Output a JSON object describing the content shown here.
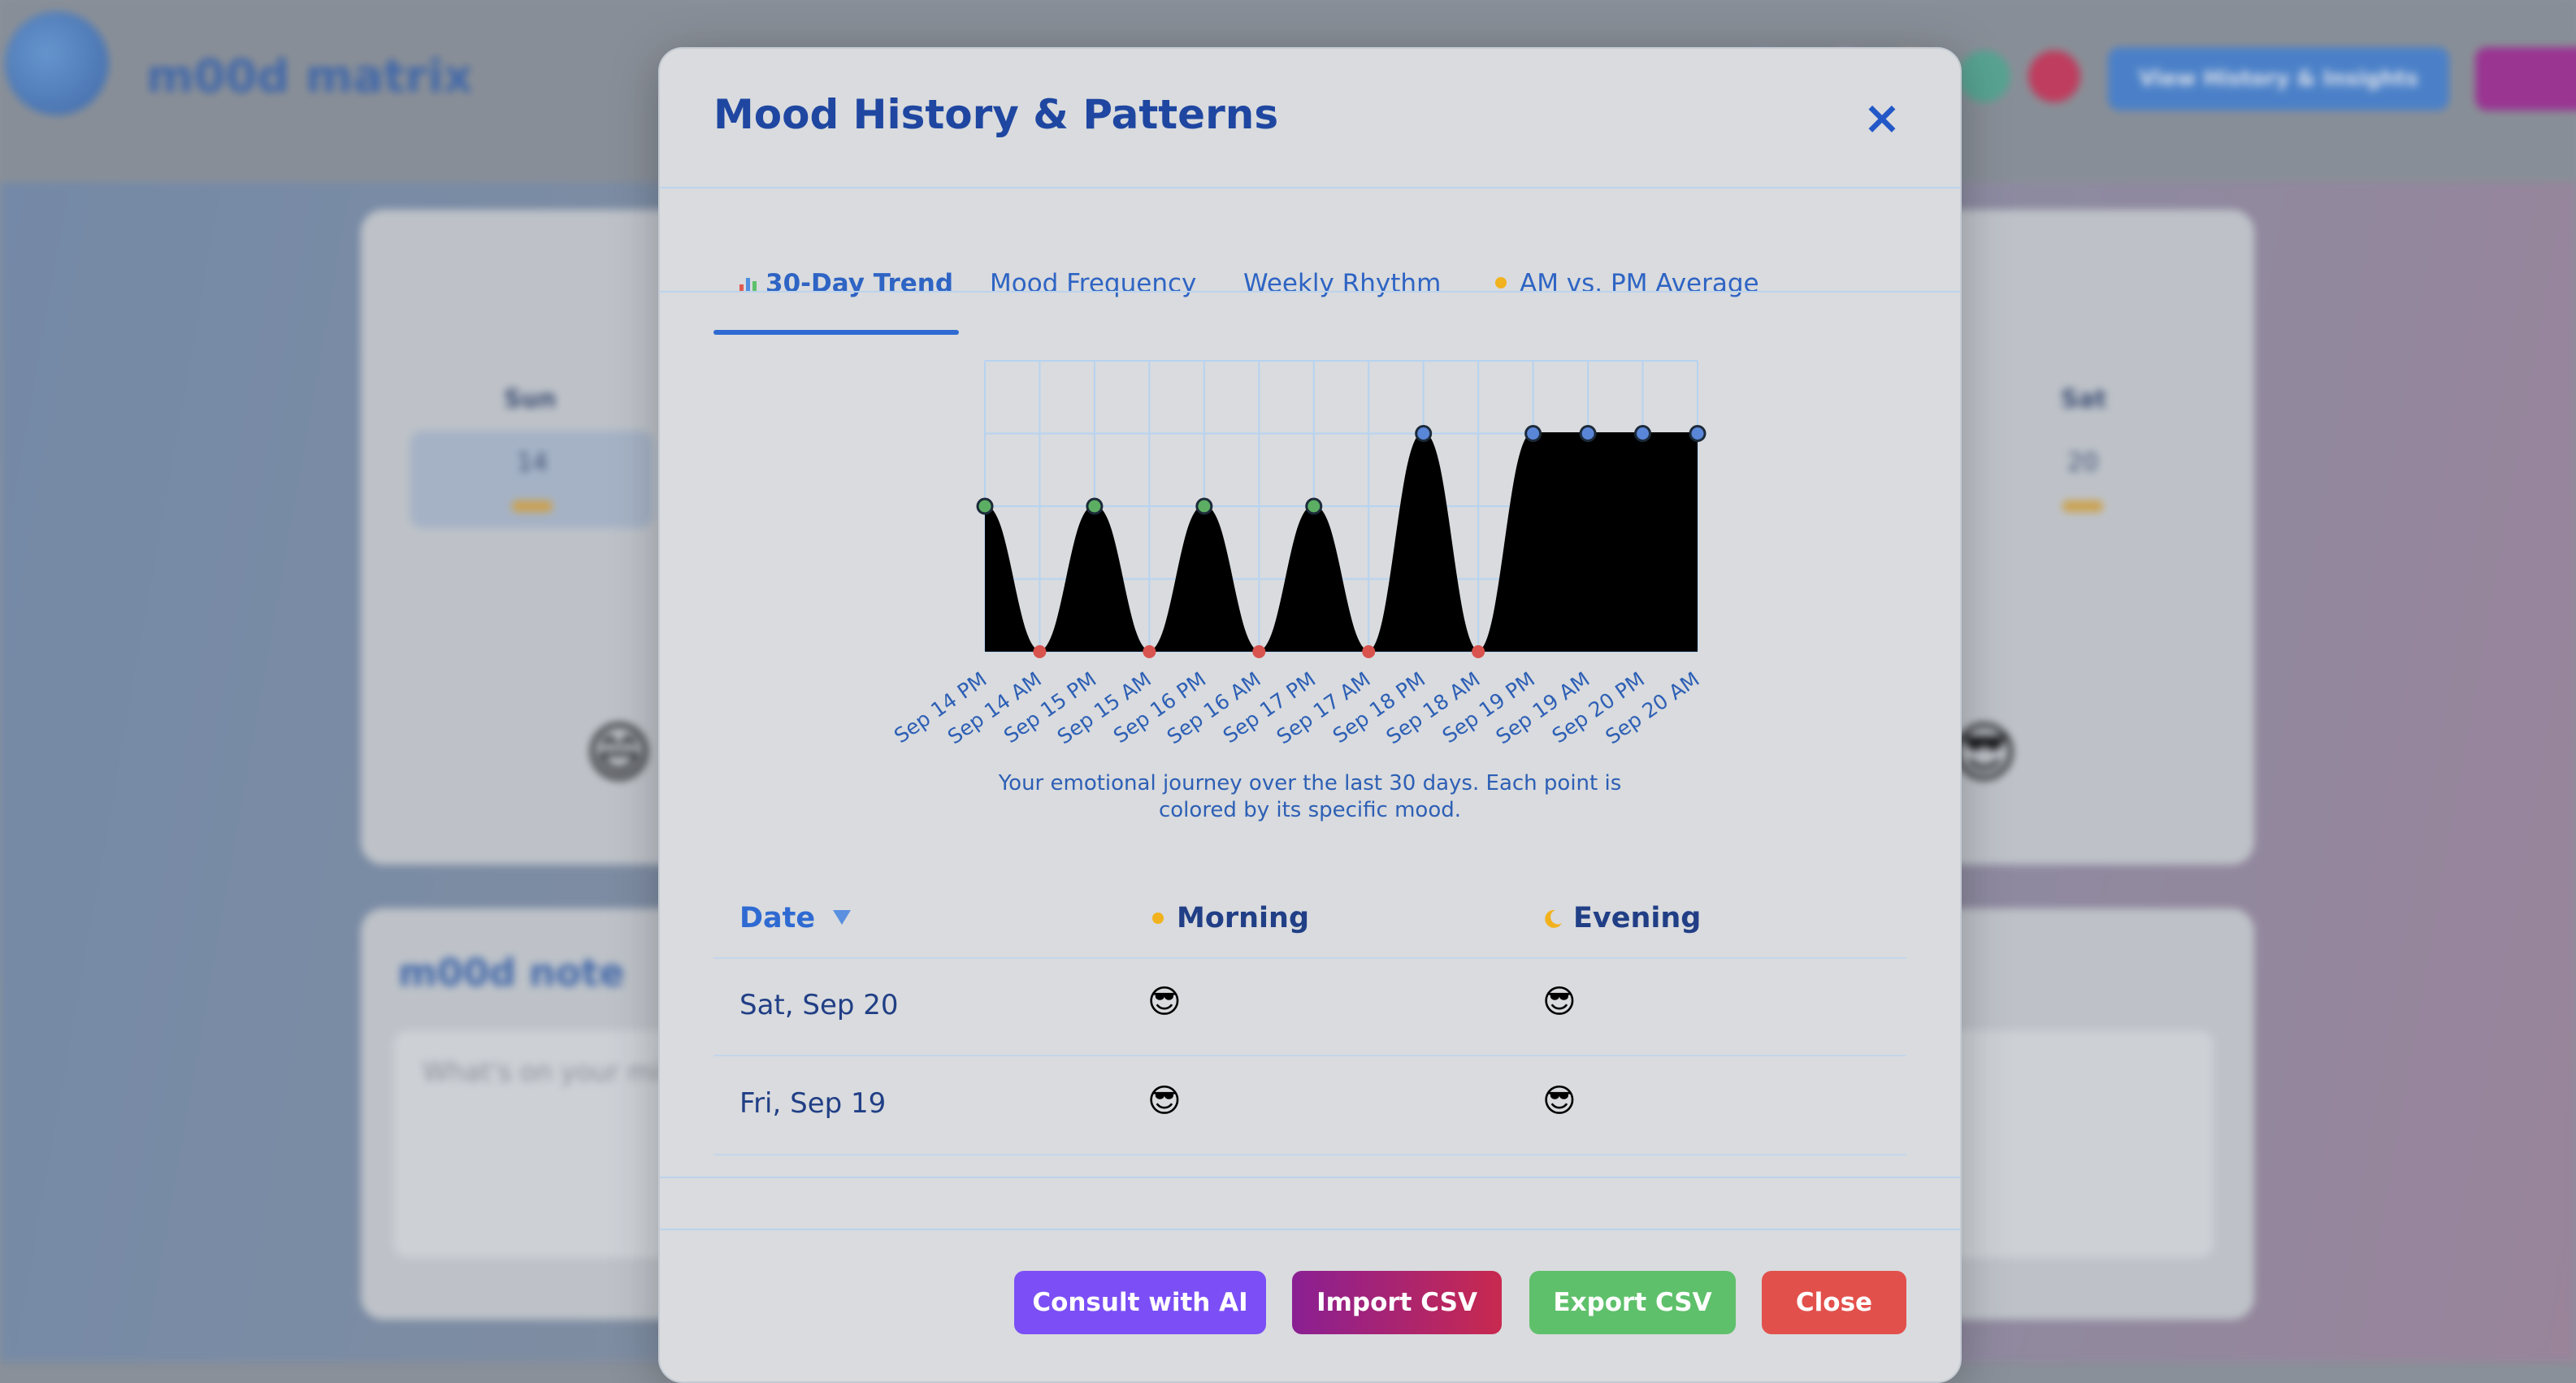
{
  "background": {
    "app_title": "m00d matrix",
    "header_button": "View History & Insights",
    "calendar": {
      "first_day_label": "Sun",
      "first_day_number": "14",
      "last_day_label": "Sat",
      "last_day_number": "20"
    },
    "note_title": "m00d note",
    "note_placeholder": "What's on your mind"
  },
  "modal": {
    "title": "Mood History & Patterns",
    "close_icon": "×",
    "tabs": [
      {
        "label": "30-Day Trend",
        "icon": "bar-chart-icon",
        "active": true
      },
      {
        "label": "Mood Frequency",
        "active": false
      },
      {
        "label": "Weekly Rhythm",
        "active": false
      },
      {
        "label": "AM vs. PM Average",
        "icon": "sun-icon",
        "active": false
      }
    ],
    "chart_caption": "Your emotional journey over the last 30 days. Each point is colored by its specific mood.",
    "table": {
      "headers": {
        "date": "Date",
        "morning": "Morning",
        "evening": "Evening"
      },
      "rows": [
        {
          "date": "Sat, Sep 20",
          "morning": "😎",
          "evening": "😎"
        },
        {
          "date": "Fri, Sep 19",
          "morning": "😎",
          "evening": "😎"
        }
      ]
    },
    "buttons": {
      "consult": "Consult with AI",
      "import": "Import CSV",
      "export": "Export CSV",
      "close": "Close"
    }
  },
  "colors": {
    "primary": "#2f6ad2",
    "consult": "#7b4ff5",
    "import_from": "#8a1f93",
    "import_to": "#c8294f",
    "export": "#5fc06b",
    "close": "#e2504b"
  },
  "chart_data": {
    "type": "area",
    "categories": [
      "Sep 14 PM",
      "Sep 14 AM",
      "Sep 15 PM",
      "Sep 15 AM",
      "Sep 16 PM",
      "Sep 16 AM",
      "Sep 17 PM",
      "Sep 17 AM",
      "Sep 18 PM",
      "Sep 18 AM",
      "Sep 19 PM",
      "Sep 19 AM",
      "Sep 20 PM",
      "Sep 20 AM"
    ],
    "values": [
      4,
      2,
      4,
      2,
      4,
      2,
      4,
      2,
      5,
      2,
      5,
      5,
      5,
      5
    ],
    "point_colors": [
      "#5cae63",
      "#d9534f",
      "#5cae63",
      "#d9534f",
      "#5cae63",
      "#d9534f",
      "#5cae63",
      "#d9534f",
      "#5a86d8",
      "#d9534f",
      "#5a86d8",
      "#5a86d8",
      "#5a86d8",
      "#5a86d8"
    ],
    "ylim": [
      2,
      6
    ],
    "grid": true,
    "fill": "#000000"
  }
}
